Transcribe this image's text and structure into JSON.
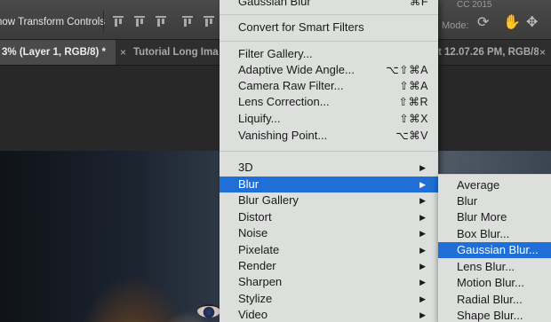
{
  "options_bar": {
    "show_transform_label": "now Transform Controls",
    "app_version": "CC 2015",
    "mode_label": "Mode:"
  },
  "tabs": {
    "active_label": "3% (Layer 1, RGB/8) *",
    "second_label": "Tutorial Long Ima",
    "third_label": "t 12.07.26 PM, RGB/8)",
    "close_glyph": "×"
  },
  "filter_menu": {
    "top_cut_label": "Gaussian Blur",
    "top_cut_shortcut": "⌘F",
    "convert_label": "Convert for Smart Filters",
    "items": [
      {
        "label": "Filter Gallery...",
        "shortcut": ""
      },
      {
        "label": "Adaptive Wide Angle...",
        "shortcut": "⌥⇧⌘A"
      },
      {
        "label": "Camera Raw Filter...",
        "shortcut": "⇧⌘A"
      },
      {
        "label": "Lens Correction...",
        "shortcut": "⇧⌘R"
      },
      {
        "label": "Liquify...",
        "shortcut": "⇧⌘X"
      },
      {
        "label": "Vanishing Point...",
        "shortcut": "⌥⌘V"
      }
    ],
    "submenus": [
      {
        "label": "3D"
      },
      {
        "label": "Blur",
        "highlighted": true
      },
      {
        "label": "Blur Gallery"
      },
      {
        "label": "Distort"
      },
      {
        "label": "Noise"
      },
      {
        "label": "Pixelate"
      },
      {
        "label": "Render"
      },
      {
        "label": "Sharpen"
      },
      {
        "label": "Stylize"
      },
      {
        "label": "Video"
      }
    ],
    "submenu_arrow": "▶"
  },
  "blur_submenu": {
    "items": [
      {
        "label": "Average"
      },
      {
        "label": "Blur"
      },
      {
        "label": "Blur More"
      },
      {
        "label": "Box Blur..."
      },
      {
        "label": "Gaussian Blur...",
        "highlighted": true
      },
      {
        "label": "Lens Blur..."
      },
      {
        "label": "Motion Blur..."
      },
      {
        "label": "Radial Blur..."
      },
      {
        "label": "Shape Blur..."
      }
    ]
  },
  "colors": {
    "menu_background": "#dcdfdc",
    "highlight": "#1f6fd6",
    "toolbar": "#3b3b3b"
  },
  "icons": {
    "right_tools": [
      "3d-orbit-icon",
      "pan-icon",
      "move-3d-icon"
    ]
  }
}
